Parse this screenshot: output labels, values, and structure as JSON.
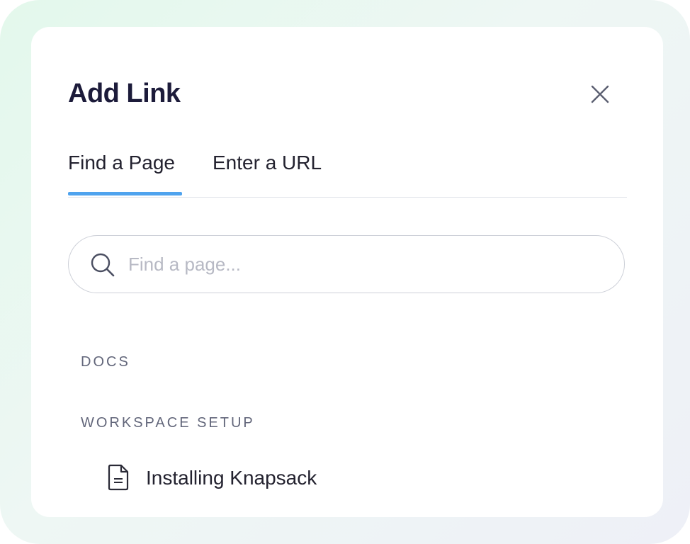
{
  "dialog": {
    "title": "Add Link",
    "close_icon": "close-icon"
  },
  "tabs": [
    {
      "label": "Find a Page",
      "active": true
    },
    {
      "label": "Enter a URL",
      "active": false
    }
  ],
  "search": {
    "placeholder": "Find a page...",
    "value": "",
    "icon": "search-icon"
  },
  "sections": [
    {
      "label": "DOCS",
      "items": []
    },
    {
      "label": "WORKSPACE SETUP",
      "items": [
        {
          "label": "Installing Knapsack",
          "icon": "document-icon"
        }
      ]
    }
  ],
  "colors": {
    "accent": "#4fa3ee",
    "title": "#1c1b3a",
    "section_label": "#62667a",
    "border": "#cdd0d8"
  }
}
